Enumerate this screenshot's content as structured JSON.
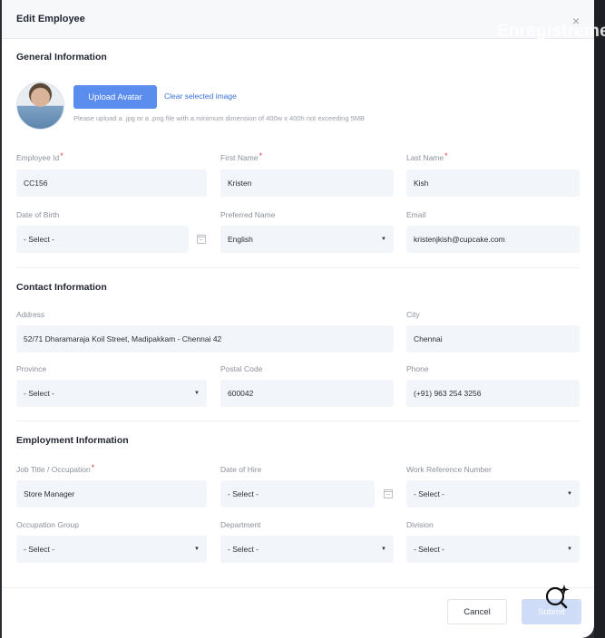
{
  "overlay_text": "Enregistreme",
  "modal": {
    "title": "Edit Employee",
    "close_glyph": "×"
  },
  "general": {
    "title": "General Information",
    "upload_label": "Upload Avatar",
    "clear_label": "Clear selected image",
    "hint": "Please upload a .jpg or a .png file with a minimum dimension of 400w x 400h not exceeding 5MB",
    "employee_id": {
      "label": "Employee Id",
      "value": "CC156",
      "required": true
    },
    "first_name": {
      "label": "First Name",
      "value": "Kristen",
      "required": true
    },
    "last_name": {
      "label": "Last Name",
      "value": "Kish",
      "required": true
    },
    "dob": {
      "label": "Date of Birth",
      "value": "- Select -"
    },
    "preferred_name": {
      "label": "Preferred Name",
      "value": "English"
    },
    "email": {
      "label": "Email",
      "value": "kristenjkish@cupcake.com"
    }
  },
  "contact": {
    "title": "Contact Information",
    "address": {
      "label": "Address",
      "value": "52/71 Dharamaraja Koil Street, Madipakkam - Chennai 42"
    },
    "city": {
      "label": "City",
      "value": "Chennai"
    },
    "province": {
      "label": "Province",
      "value": "- Select -"
    },
    "postal_code": {
      "label": "Postal Code",
      "value": "600042"
    },
    "phone": {
      "label": "Phone",
      "value": "(+91) 963 254 3256"
    }
  },
  "employment": {
    "title": "Employment Information",
    "job_title": {
      "label": "Job Title / Occupation",
      "value": "Store Manager",
      "required": true
    },
    "date_of_hire": {
      "label": "Date of Hire",
      "value": "- Select -"
    },
    "work_ref": {
      "label": "Work Reference Number",
      "value": "- Select -"
    },
    "occupation_group": {
      "label": "Occupation Group",
      "value": "- Select -"
    },
    "department": {
      "label": "Department",
      "value": "- Select -"
    },
    "division": {
      "label": "Division",
      "value": "- Select -"
    }
  },
  "footer": {
    "cancel_label": "Cancel",
    "submit_label": "Submit"
  },
  "colors": {
    "primary": "#5b8def",
    "link": "#3a73d8",
    "required": "#e0424f",
    "field_bg": "#f2f5fa"
  },
  "icons": {
    "close": "close-icon",
    "calendar": "calendar-icon",
    "dropdown": "chevron-down-icon",
    "ai": "sparkle-search-icon"
  }
}
